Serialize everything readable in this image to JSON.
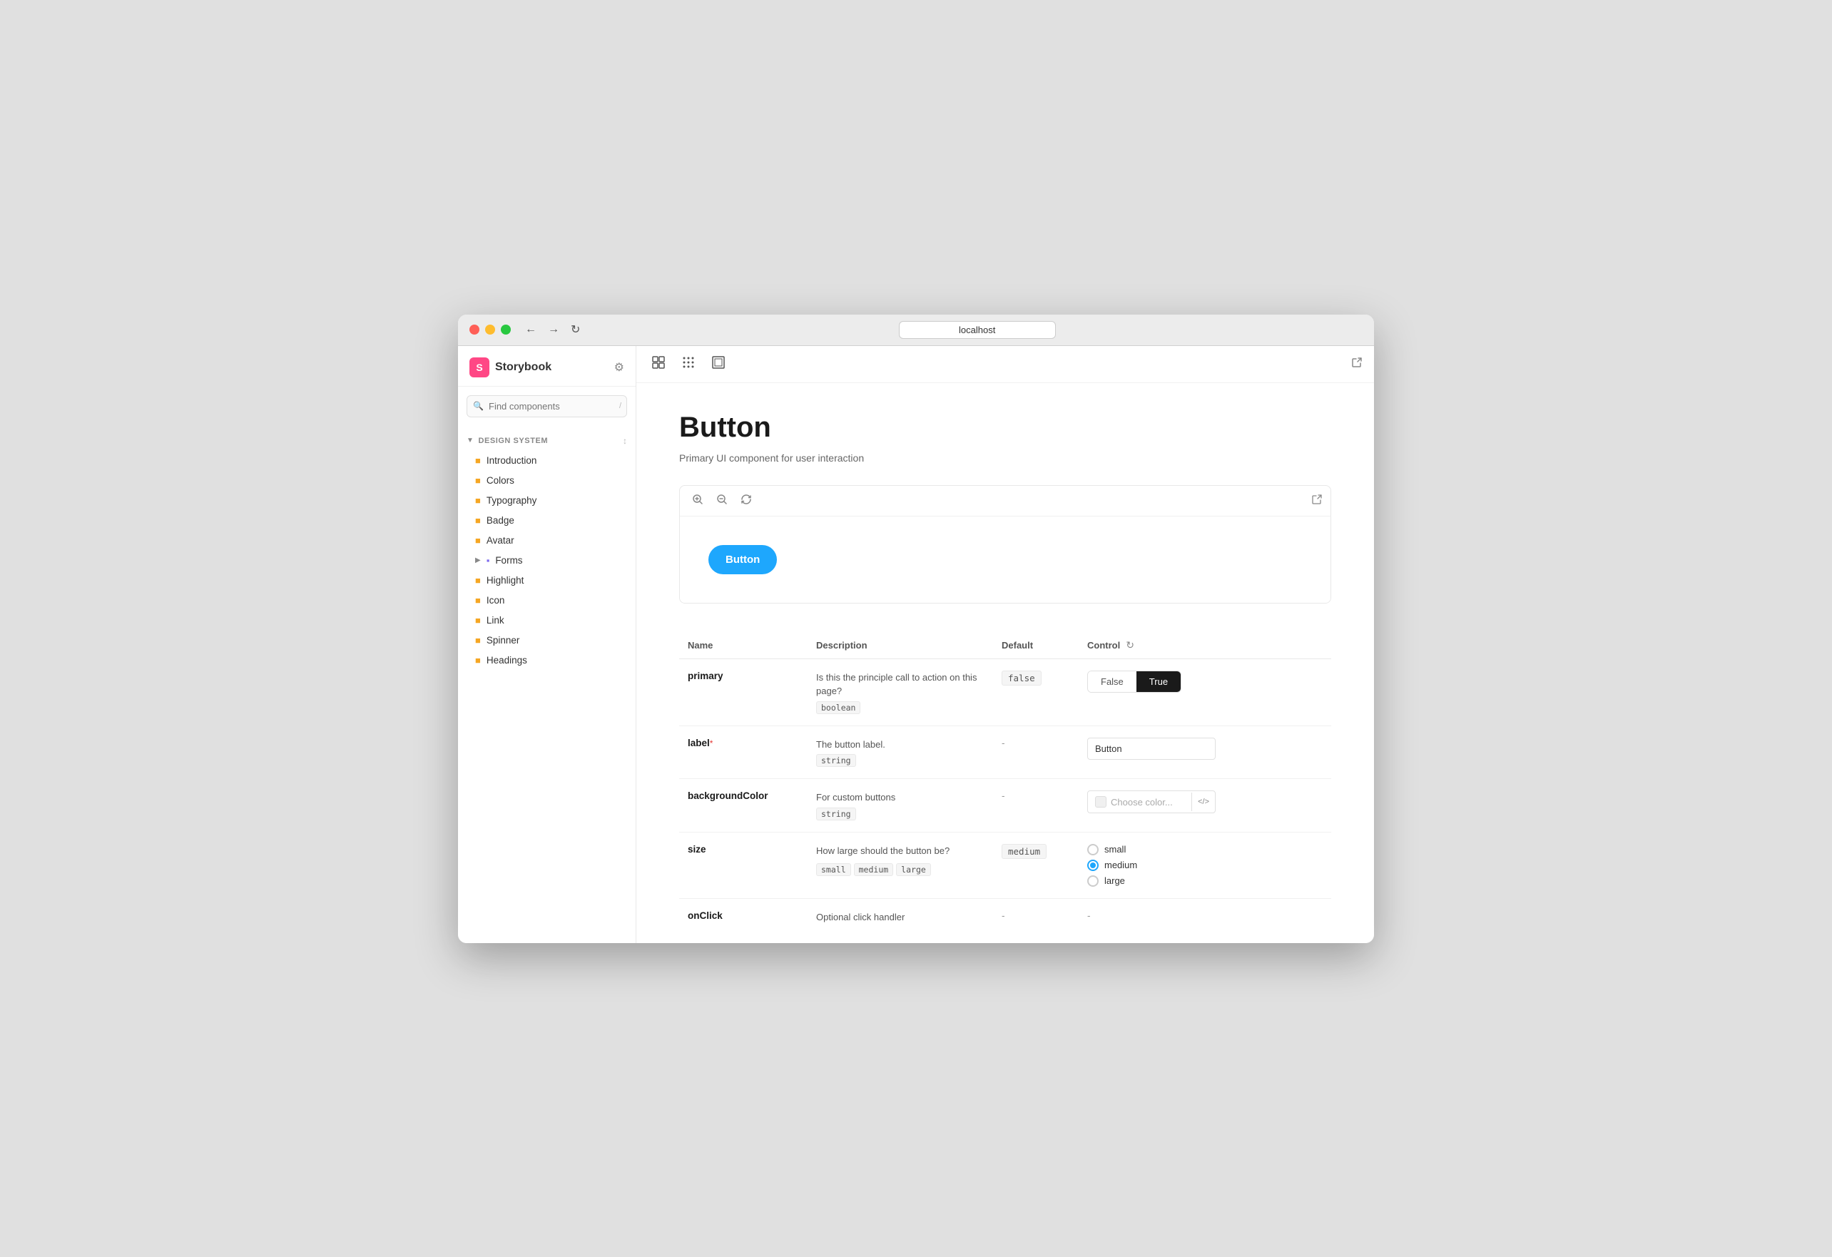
{
  "window": {
    "title": "localhost"
  },
  "sidebar": {
    "logo_text": "Storybook",
    "search_placeholder": "Find components",
    "search_shortcut": "/",
    "section_label": "DESIGN SYSTEM",
    "items": [
      {
        "id": "introduction",
        "label": "Introduction",
        "icon": "doc"
      },
      {
        "id": "colors",
        "label": "Colors",
        "icon": "doc"
      },
      {
        "id": "typography",
        "label": "Typography",
        "icon": "doc"
      },
      {
        "id": "badge",
        "label": "Badge",
        "icon": "doc"
      },
      {
        "id": "avatar",
        "label": "Avatar",
        "icon": "doc"
      },
      {
        "id": "forms",
        "label": "Forms",
        "icon": "folder",
        "expandable": true
      },
      {
        "id": "highlight",
        "label": "Highlight",
        "icon": "doc"
      },
      {
        "id": "icon",
        "label": "Icon",
        "icon": "doc"
      },
      {
        "id": "link",
        "label": "Link",
        "icon": "doc"
      },
      {
        "id": "spinner",
        "label": "Spinner",
        "icon": "doc"
      },
      {
        "id": "headings",
        "label": "Headings",
        "icon": "doc"
      }
    ]
  },
  "toolbar": {
    "btn1": "⊞",
    "btn2": "⊕",
    "btn3": "⊡"
  },
  "content": {
    "title": "Button",
    "subtitle": "Primary UI component for user interaction",
    "demo_button_label": "Button"
  },
  "props_table": {
    "headers": {
      "name": "Name",
      "description": "Description",
      "default": "Default",
      "control": "Control"
    },
    "rows": [
      {
        "name": "primary",
        "required": false,
        "description": "Is this the principle call to action on this page?",
        "type": "boolean",
        "default": "false",
        "control_type": "bool_toggle",
        "control_false": "False",
        "control_true": "True",
        "control_active": "True"
      },
      {
        "name": "label",
        "required": true,
        "description": "The button label.",
        "type": "string",
        "default": "-",
        "control_type": "text_input",
        "control_value": "Button"
      },
      {
        "name": "backgroundColor",
        "required": false,
        "description": "For custom buttons",
        "type": "string",
        "default": "-",
        "control_type": "color",
        "control_placeholder": "Choose color..."
      },
      {
        "name": "size",
        "required": false,
        "description": "How large should the button be?",
        "types": [
          "small",
          "medium",
          "large"
        ],
        "default": "medium",
        "control_type": "radio",
        "options": [
          "small",
          "medium",
          "large"
        ],
        "selected": "medium"
      },
      {
        "name": "onClick",
        "required": false,
        "description": "Optional click handler",
        "type": null,
        "default": "-",
        "control_type": "none"
      }
    ]
  }
}
